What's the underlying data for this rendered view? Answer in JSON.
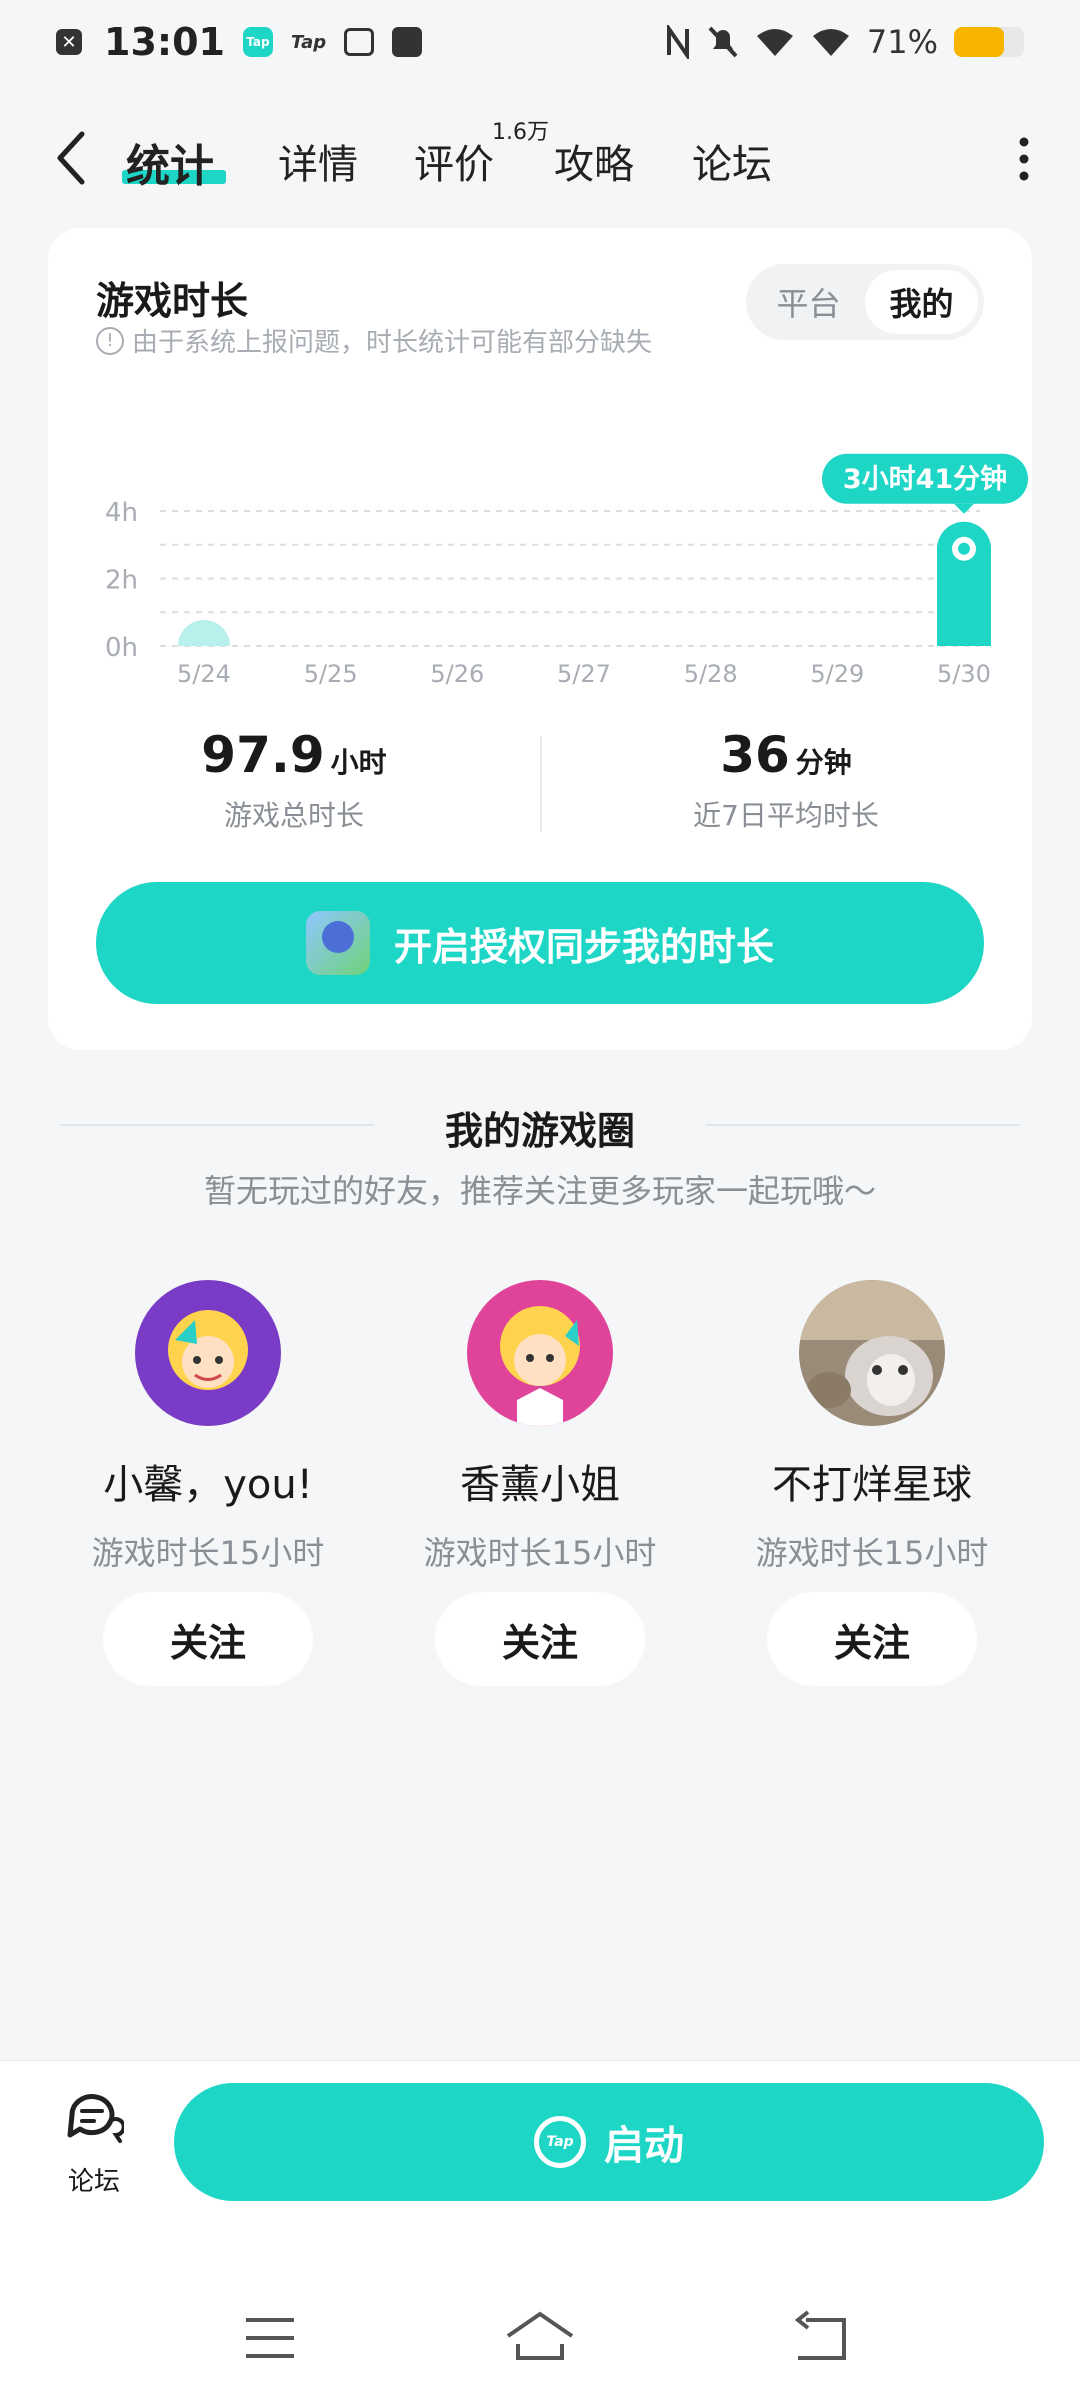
{
  "status_bar": {
    "time": "13:01",
    "tap_icon_text": "Tap",
    "battery_text": "71%",
    "battery_level": 0.71
  },
  "nav": {
    "tabs": [
      {
        "label": "统计",
        "active": true
      },
      {
        "label": "详情"
      },
      {
        "label": "评价",
        "badge": "1.6万"
      },
      {
        "label": "攻略"
      },
      {
        "label": "论坛"
      }
    ]
  },
  "stats_card": {
    "title": "游戏时长",
    "note": "由于系统上报问题，时长统计可能有部分缺失",
    "toggle": [
      "平台",
      "我的"
    ],
    "toggle_active": "我的",
    "total": {
      "value": "97.9",
      "unit": "小时",
      "label": "游戏总时长"
    },
    "average": {
      "value": "36",
      "unit": "分钟",
      "label": "近7日平均时长"
    },
    "auth_button": "开启授权同步我的时长"
  },
  "chart_data": {
    "type": "bar",
    "categories": [
      "5/24",
      "5/25",
      "5/26",
      "5/27",
      "5/28",
      "5/29",
      "5/30"
    ],
    "values": [
      0.15,
      0,
      0,
      0,
      0,
      0,
      3.68
    ],
    "y_ticks": [
      "0h",
      "2h",
      "4h"
    ],
    "ylim": [
      0,
      4
    ],
    "highlight_label": "3小时41分钟",
    "highlight_index": 6,
    "colors": {
      "bar": "#1ed6c6",
      "bar_faint": "#b8f1ec",
      "grid": "#dcdfe2"
    }
  },
  "game_circle": {
    "title": "我的游戏圈",
    "subtitle": "暂无玩过的好友，推荐关注更多玩家一起玩哦～",
    "users": [
      {
        "name": "小馨，you!",
        "time": "游戏时长15小时",
        "follow": "关注",
        "avatar_bg": "#7a3cc6"
      },
      {
        "name": "香薰小姐",
        "time": "游戏时长15小时",
        "follow": "关注",
        "avatar_bg": "#e0449a"
      },
      {
        "name": "不打烊星球",
        "time": "游戏时长15小时",
        "follow": "关注",
        "avatar_bg": "#9a8a78"
      }
    ]
  },
  "bottom_bar": {
    "forum_label": "论坛",
    "launch_label": "启动",
    "launch_icon_text": "Tap"
  },
  "colors": {
    "accent": "#1ed6c6",
    "background": "#f4f6f8"
  }
}
